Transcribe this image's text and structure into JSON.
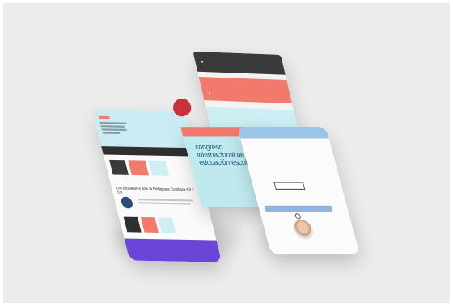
{
  "colors": {
    "background": "#ececec",
    "dark": "#3a3a3a",
    "coral": "#f27a6c",
    "light_blue": "#cdeef3",
    "purple": "#6b45d8",
    "heart_red": "#c8323c",
    "title_blue": "#1f5d78"
  },
  "poster": {
    "title": "congreso internacional de educación escolapia"
  },
  "left_phone": {
    "heading": "Los educadores ante la Pedagogía Escolapia 4.0 y 5.0"
  },
  "icons": [
    "heart-illustration-icon",
    "speaker-avatar-icon",
    "map-pin-icon"
  ]
}
